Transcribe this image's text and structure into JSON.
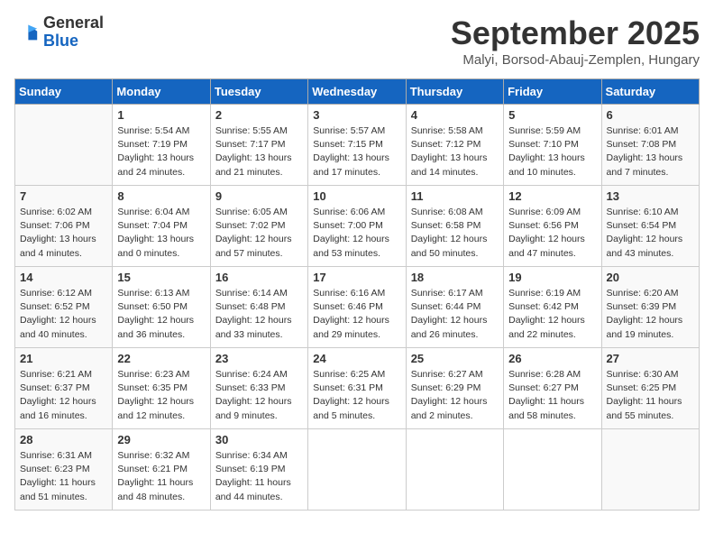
{
  "header": {
    "logo_line1": "General",
    "logo_line2": "Blue",
    "month": "September 2025",
    "location": "Malyi, Borsod-Abauj-Zemplen, Hungary"
  },
  "weekdays": [
    "Sunday",
    "Monday",
    "Tuesday",
    "Wednesday",
    "Thursday",
    "Friday",
    "Saturday"
  ],
  "weeks": [
    [
      {
        "day": "",
        "info": ""
      },
      {
        "day": "1",
        "info": "Sunrise: 5:54 AM\nSunset: 7:19 PM\nDaylight: 13 hours\nand 24 minutes."
      },
      {
        "day": "2",
        "info": "Sunrise: 5:55 AM\nSunset: 7:17 PM\nDaylight: 13 hours\nand 21 minutes."
      },
      {
        "day": "3",
        "info": "Sunrise: 5:57 AM\nSunset: 7:15 PM\nDaylight: 13 hours\nand 17 minutes."
      },
      {
        "day": "4",
        "info": "Sunrise: 5:58 AM\nSunset: 7:12 PM\nDaylight: 13 hours\nand 14 minutes."
      },
      {
        "day": "5",
        "info": "Sunrise: 5:59 AM\nSunset: 7:10 PM\nDaylight: 13 hours\nand 10 minutes."
      },
      {
        "day": "6",
        "info": "Sunrise: 6:01 AM\nSunset: 7:08 PM\nDaylight: 13 hours\nand 7 minutes."
      }
    ],
    [
      {
        "day": "7",
        "info": "Sunrise: 6:02 AM\nSunset: 7:06 PM\nDaylight: 13 hours\nand 4 minutes."
      },
      {
        "day": "8",
        "info": "Sunrise: 6:04 AM\nSunset: 7:04 PM\nDaylight: 13 hours\nand 0 minutes."
      },
      {
        "day": "9",
        "info": "Sunrise: 6:05 AM\nSunset: 7:02 PM\nDaylight: 12 hours\nand 57 minutes."
      },
      {
        "day": "10",
        "info": "Sunrise: 6:06 AM\nSunset: 7:00 PM\nDaylight: 12 hours\nand 53 minutes."
      },
      {
        "day": "11",
        "info": "Sunrise: 6:08 AM\nSunset: 6:58 PM\nDaylight: 12 hours\nand 50 minutes."
      },
      {
        "day": "12",
        "info": "Sunrise: 6:09 AM\nSunset: 6:56 PM\nDaylight: 12 hours\nand 47 minutes."
      },
      {
        "day": "13",
        "info": "Sunrise: 6:10 AM\nSunset: 6:54 PM\nDaylight: 12 hours\nand 43 minutes."
      }
    ],
    [
      {
        "day": "14",
        "info": "Sunrise: 6:12 AM\nSunset: 6:52 PM\nDaylight: 12 hours\nand 40 minutes."
      },
      {
        "day": "15",
        "info": "Sunrise: 6:13 AM\nSunset: 6:50 PM\nDaylight: 12 hours\nand 36 minutes."
      },
      {
        "day": "16",
        "info": "Sunrise: 6:14 AM\nSunset: 6:48 PM\nDaylight: 12 hours\nand 33 minutes."
      },
      {
        "day": "17",
        "info": "Sunrise: 6:16 AM\nSunset: 6:46 PM\nDaylight: 12 hours\nand 29 minutes."
      },
      {
        "day": "18",
        "info": "Sunrise: 6:17 AM\nSunset: 6:44 PM\nDaylight: 12 hours\nand 26 minutes."
      },
      {
        "day": "19",
        "info": "Sunrise: 6:19 AM\nSunset: 6:42 PM\nDaylight: 12 hours\nand 22 minutes."
      },
      {
        "day": "20",
        "info": "Sunrise: 6:20 AM\nSunset: 6:39 PM\nDaylight: 12 hours\nand 19 minutes."
      }
    ],
    [
      {
        "day": "21",
        "info": "Sunrise: 6:21 AM\nSunset: 6:37 PM\nDaylight: 12 hours\nand 16 minutes."
      },
      {
        "day": "22",
        "info": "Sunrise: 6:23 AM\nSunset: 6:35 PM\nDaylight: 12 hours\nand 12 minutes."
      },
      {
        "day": "23",
        "info": "Sunrise: 6:24 AM\nSunset: 6:33 PM\nDaylight: 12 hours\nand 9 minutes."
      },
      {
        "day": "24",
        "info": "Sunrise: 6:25 AM\nSunset: 6:31 PM\nDaylight: 12 hours\nand 5 minutes."
      },
      {
        "day": "25",
        "info": "Sunrise: 6:27 AM\nSunset: 6:29 PM\nDaylight: 12 hours\nand 2 minutes."
      },
      {
        "day": "26",
        "info": "Sunrise: 6:28 AM\nSunset: 6:27 PM\nDaylight: 11 hours\nand 58 minutes."
      },
      {
        "day": "27",
        "info": "Sunrise: 6:30 AM\nSunset: 6:25 PM\nDaylight: 11 hours\nand 55 minutes."
      }
    ],
    [
      {
        "day": "28",
        "info": "Sunrise: 6:31 AM\nSunset: 6:23 PM\nDaylight: 11 hours\nand 51 minutes."
      },
      {
        "day": "29",
        "info": "Sunrise: 6:32 AM\nSunset: 6:21 PM\nDaylight: 11 hours\nand 48 minutes."
      },
      {
        "day": "30",
        "info": "Sunrise: 6:34 AM\nSunset: 6:19 PM\nDaylight: 11 hours\nand 44 minutes."
      },
      {
        "day": "",
        "info": ""
      },
      {
        "day": "",
        "info": ""
      },
      {
        "day": "",
        "info": ""
      },
      {
        "day": "",
        "info": ""
      }
    ]
  ]
}
